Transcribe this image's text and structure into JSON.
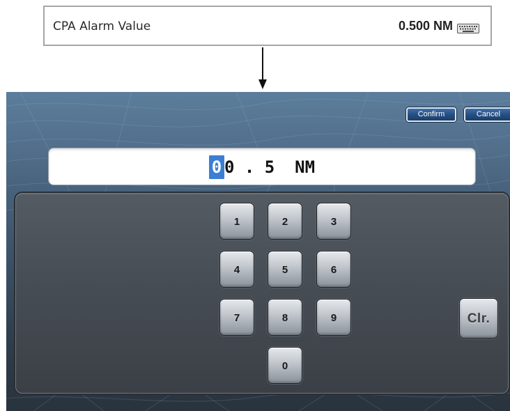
{
  "setting": {
    "label": "CPA Alarm Value",
    "value": "0.500 NM",
    "edit_icon": "keyboard-icon"
  },
  "arrow_icon": "down-arrow-icon",
  "dialog": {
    "confirm_label": "Confirm",
    "cancel_label": "Cancel",
    "display": {
      "cursor_digit": "0",
      "rest": "0 . 5  NM"
    },
    "keys": [
      {
        "label": "1"
      },
      {
        "label": "2"
      },
      {
        "label": "3"
      },
      {
        "label": "4"
      },
      {
        "label": "5"
      },
      {
        "label": "6"
      },
      {
        "label": "7"
      },
      {
        "label": "8"
      },
      {
        "label": "9"
      },
      {
        "label": "0"
      }
    ],
    "clear_label": "Clr."
  },
  "colors": {
    "button_blue": "#244d80",
    "cursor_highlight": "#3b7fd4",
    "screen_background": "#4a6580"
  }
}
